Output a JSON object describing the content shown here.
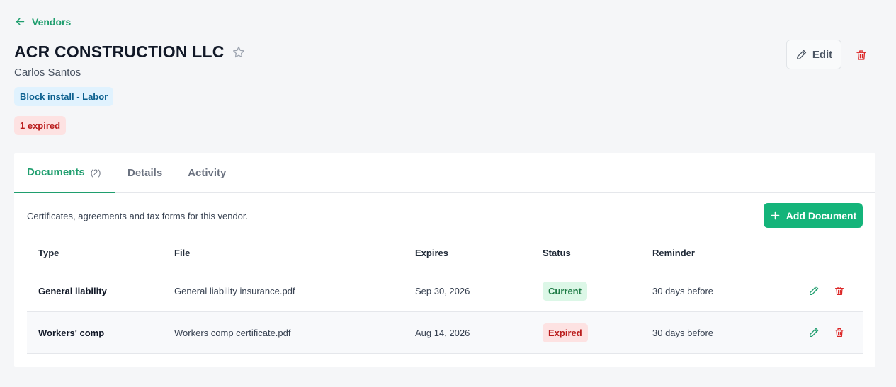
{
  "nav": {
    "back_label": "Vendors"
  },
  "vendor": {
    "name": "ACR CONSTRUCTION LLC",
    "contact": "Carlos Santos",
    "tag": "Block install - Labor",
    "expired_badge": "1 expired"
  },
  "actions": {
    "edit_label": "Edit"
  },
  "tabs": [
    {
      "label": "Documents",
      "count": "(2)"
    },
    {
      "label": "Details"
    },
    {
      "label": "Activity"
    }
  ],
  "documents": {
    "description": "Certificates, agreements and tax forms for this vendor.",
    "add_label": "Add Document",
    "columns": [
      "Type",
      "File",
      "Expires",
      "Status",
      "Reminder"
    ],
    "rows": [
      {
        "type": "General liability",
        "file": "General liability insurance.pdf",
        "expires": "Sep 30, 2026",
        "status": "Current",
        "reminder": "30 days before"
      },
      {
        "type": "Workers' comp",
        "file": "Workers comp certificate.pdf",
        "expires": "Aug 14, 2026",
        "status": "Expired",
        "reminder": "30 days before"
      }
    ]
  },
  "colors": {
    "accent": "#1f9e6e",
    "primary_button": "#14b47a",
    "danger": "#dc2626",
    "tag_bg": "#e0f2fe",
    "current_bg": "#dcf7e7",
    "expired_bg": "#fde2e2"
  },
  "icons": {
    "back": "arrow-left-icon",
    "favorite": "star-icon",
    "edit": "pencil-icon",
    "delete": "trash-icon",
    "add": "plus-icon"
  }
}
